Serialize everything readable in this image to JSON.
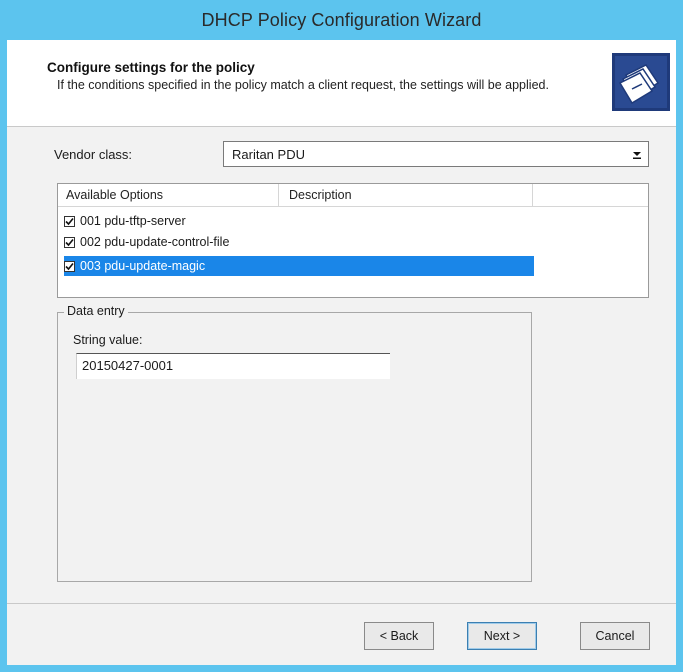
{
  "window": {
    "title": "DHCP Policy Configuration Wizard"
  },
  "header": {
    "title": "Configure settings for the policy",
    "subtitle": "If the conditions specified in the policy match a client request, the settings will be applied.",
    "icon": "wizard-folder-icon"
  },
  "vendor": {
    "label": "Vendor class:",
    "value": "Raritan PDU"
  },
  "options": {
    "columns": [
      "Available Options",
      "Description",
      ""
    ],
    "rows": [
      {
        "label": "001 pdu-tftp-server",
        "checked": true,
        "selected": false
      },
      {
        "label": "002 pdu-update-control-file",
        "checked": true,
        "selected": false
      },
      {
        "label": "003 pdu-update-magic",
        "checked": true,
        "selected": true
      }
    ]
  },
  "dataentry": {
    "legend": "Data entry",
    "string_label": "String value:",
    "string_value": "20150427-0001"
  },
  "buttons": {
    "back": "< Back",
    "next": "Next >",
    "cancel": "Cancel"
  },
  "colors": {
    "titlebar": "#5cc4ee",
    "selection": "#1a86e8"
  }
}
